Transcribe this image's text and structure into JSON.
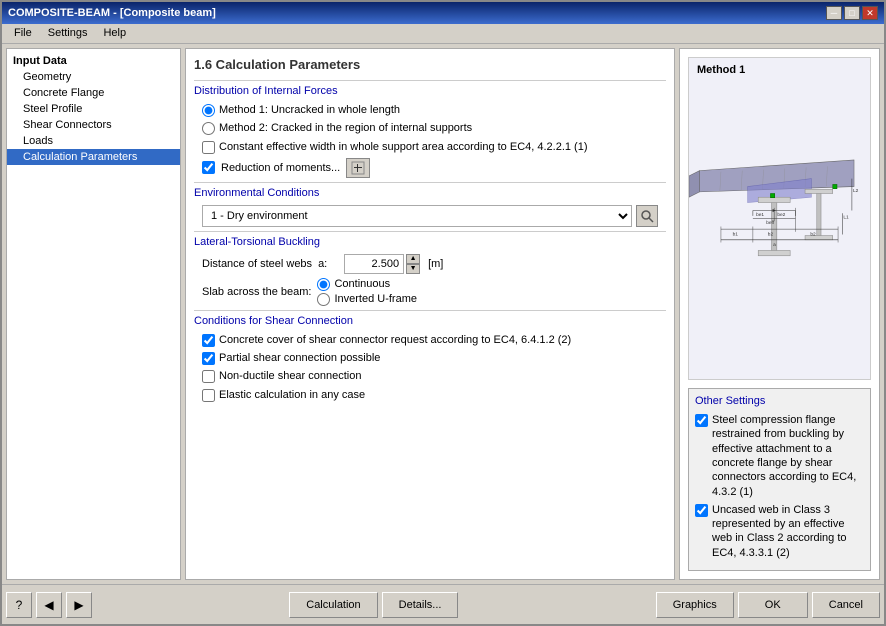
{
  "window": {
    "title": "COMPOSITE-BEAM - [Composite beam]",
    "close_btn": "✕",
    "min_btn": "─",
    "max_btn": "□"
  },
  "menu": {
    "items": [
      "File",
      "Settings",
      "Help"
    ]
  },
  "sidebar": {
    "section": "Input Data",
    "items": [
      {
        "label": "Geometry",
        "active": false
      },
      {
        "label": "Concrete Flange",
        "active": false
      },
      {
        "label": "Steel Profile",
        "active": false
      },
      {
        "label": "Shear Connectors",
        "active": false
      },
      {
        "label": "Loads",
        "active": false
      },
      {
        "label": "Calculation Parameters",
        "active": true
      }
    ]
  },
  "main": {
    "panel_title": "1.6 Calculation Parameters",
    "distribution_title": "Distribution of Internal Forces",
    "method1_label": "Method 1: Uncracked in whole length",
    "method2_label": "Method 2: Cracked in the region of internal supports",
    "constant_width_label": "Constant effective width in whole support area according to EC4, 4.2.2.1 (1)",
    "reduction_label": "Reduction of moments...",
    "env_title": "Environmental Conditions",
    "env_value": "1 - Dry environment",
    "lt_title": "Lateral-Torsional Buckling",
    "distance_label": "Distance of steel webs",
    "distance_a_label": "a:",
    "distance_value": "2.500",
    "distance_unit": "[m]",
    "slab_label": "Slab across the beam:",
    "slab_continuous": "Continuous",
    "slab_inverted": "Inverted U-frame",
    "shear_title": "Conditions for Shear Connection",
    "shear_cb1": "Concrete cover of shear connector request according to EC4, 6.4.1.2 (2)",
    "shear_cb2": "Partial shear connection possible",
    "shear_cb3": "Non-ductile shear connection",
    "shear_cb4": "Elastic calculation in any case",
    "diagram_label": "Method 1",
    "other_title": "Other Settings",
    "other_cb1": "Steel compression flange restrained from buckling by effective attachment to a concrete flange by shear connectors according to EC4, 4.3.2 (1)",
    "other_cb2": "Uncased web in Class 3 represented by an effective web in Class 2 according to EC4, 4.3.3.1 (2)"
  },
  "bottom": {
    "help_icon": "?",
    "back_icon": "◀",
    "forward_icon": "▶",
    "calculation_label": "Calculation",
    "details_label": "Details...",
    "graphics_label": "Graphics",
    "ok_label": "OK",
    "cancel_label": "Cancel"
  }
}
